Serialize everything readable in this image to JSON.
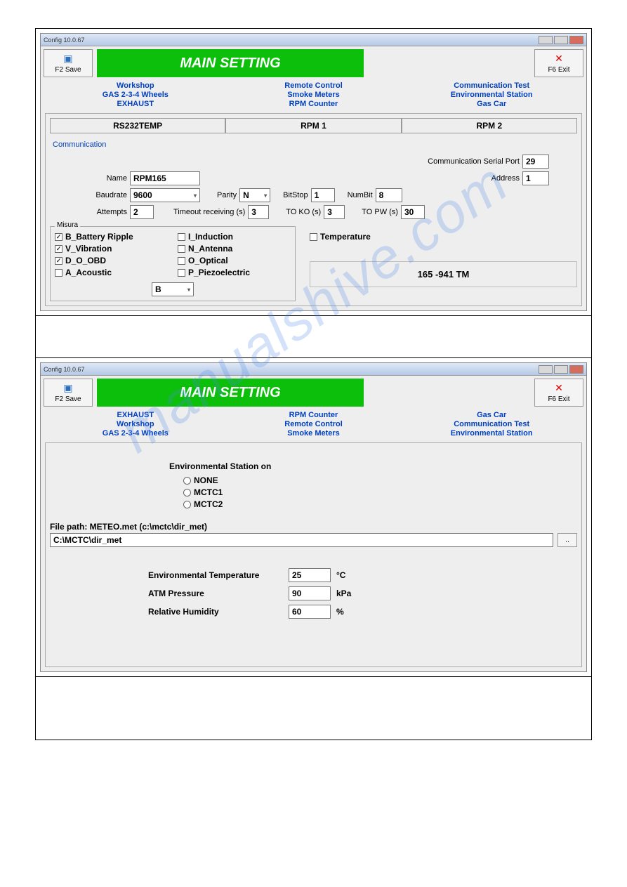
{
  "watermark": "manualshive.com",
  "win1": {
    "title": "Config 10.0.67",
    "banner": "MAIN SETTING",
    "save_label": "F2 Save",
    "exit_label": "F6 Exit",
    "tabrows": [
      [
        "Workshop",
        "Remote Control",
        "Communication Test"
      ],
      [
        "GAS 2-3-4 Wheels",
        "Smoke Meters",
        "Environmental Station"
      ],
      [
        "EXHAUST",
        "RPM Counter",
        "Gas Car"
      ]
    ],
    "subtabs": [
      "RS232TEMP",
      "RPM 1",
      "RPM 2"
    ],
    "group": "Communication",
    "comm_port_label": "Communication Serial Port",
    "comm_port": "29",
    "name_label": "Name",
    "name": "RPM165",
    "address_label": "Address",
    "address": "1",
    "baud_label": "Baudrate",
    "baud": "9600",
    "parity_label": "Parity",
    "parity": "N",
    "bitstop_label": "BitStop",
    "bitstop": "1",
    "numbit_label": "NumBit",
    "numbit": "8",
    "attempts_label": "Attempts",
    "attempts": "2",
    "timeout_label": "Timeout receiving (s)",
    "timeout": "3",
    "toko_label": "TO KO (s)",
    "toko": "3",
    "topw_label": "TO PW (s)",
    "topw": "30",
    "misura_label": "Misura",
    "chk_left": [
      {
        "label": "B_Battery Ripple",
        "on": true
      },
      {
        "label": "V_Vibration",
        "on": true
      },
      {
        "label": "D_O_OBD",
        "on": true
      },
      {
        "label": "A_Acoustic",
        "on": false
      }
    ],
    "chk_right": [
      {
        "label": "I_Induction",
        "on": false
      },
      {
        "label": "N_Antenna",
        "on": false
      },
      {
        "label": "O_Optical",
        "on": false
      },
      {
        "label": "P_Piezoelectric",
        "on": false
      }
    ],
    "misura_combo": "B",
    "temp_chk": "Temperature",
    "temp_box": "165 -941 TM"
  },
  "win2": {
    "title": "Config 10.0.67",
    "banner": "MAIN SETTING",
    "save_label": "F2 Save",
    "exit_label": "F6 Exit",
    "tabrows": [
      [
        "EXHAUST",
        "RPM Counter",
        "Gas Car"
      ],
      [
        "Workshop",
        "Remote Control",
        "Communication Test"
      ],
      [
        "GAS 2-3-4 Wheels",
        "Smoke Meters",
        "Environmental Station"
      ]
    ],
    "env_label": "Environmental Station on",
    "radios": [
      "NONE",
      "MCTC1",
      "MCTC2"
    ],
    "filepath_label": "File path: METEO.met (c:\\mctc\\dir_met)",
    "filepath": "C:\\MCTC\\dir_met",
    "browse": "..",
    "rows": [
      {
        "label": "Environmental Temperature",
        "value": "25",
        "unit": "°C"
      },
      {
        "label": "ATM Pressure",
        "value": "90",
        "unit": "kPa"
      },
      {
        "label": "Relative Humidity",
        "value": "60",
        "unit": "%"
      }
    ]
  }
}
